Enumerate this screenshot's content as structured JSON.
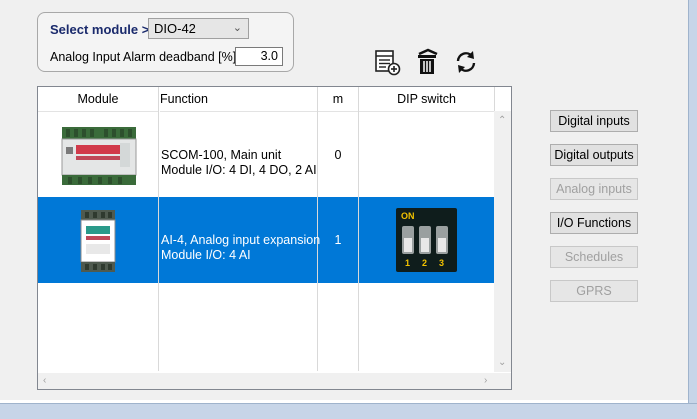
{
  "module_box": {
    "select_label": "Select module >",
    "selected_module": "DIO-42",
    "deadband_label": "Analog Input Alarm deadband [%]",
    "deadband_value": "3.0"
  },
  "toolbar": {
    "add_icon": "list-add-icon",
    "delete_icon": "trash-icon",
    "refresh_icon": "refresh-icon"
  },
  "grid": {
    "headers": [
      "Module",
      "Function",
      "m",
      "DIP switch"
    ],
    "rows": [
      {
        "function_line1": "SCOM-100, Main unit",
        "function_line2": "Module I/O: 4 DI, 4 DO, 2 AI",
        "m": "0",
        "selected": false
      },
      {
        "function_line1": "AI-4, Analog input expansion",
        "function_line2": "Module I/O: 4 AI",
        "m": "1",
        "selected": true,
        "dip": {
          "label": "ON",
          "switches": [
            "1",
            "2",
            "3"
          ]
        }
      }
    ]
  },
  "side_buttons": [
    {
      "label": "Digital inputs",
      "enabled": true
    },
    {
      "label": "Digital outputs",
      "enabled": true
    },
    {
      "label": "Analog inputs",
      "enabled": false
    },
    {
      "label": "I/O Functions",
      "enabled": true
    },
    {
      "label": "Schedules",
      "enabled": false
    },
    {
      "label": "GPRS",
      "enabled": false
    }
  ],
  "colors": {
    "selection": "#0078d7",
    "label_blue": "#1a2a6c",
    "window_frame": "#c7d5e8"
  }
}
